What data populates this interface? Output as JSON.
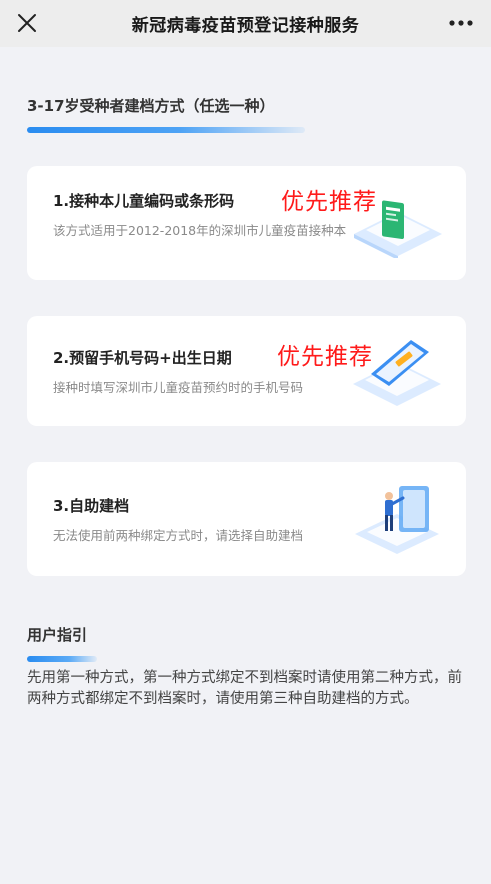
{
  "header": {
    "title": "新冠病毒疫苗预登记接种服务",
    "close_icon": "close-icon",
    "more_icon": "more-icon"
  },
  "section": {
    "title": "3-17岁受种者建档方式（任选一种）"
  },
  "cards": [
    {
      "title": "1.接种本儿童编码或条形码",
      "desc": "该方式适用于2012-2018年的深圳市儿童疫苗接种本",
      "badge": "优先推荐",
      "illustration": "vaccination-book-icon"
    },
    {
      "title": "2.预留手机号码+出生日期",
      "desc": "接种时填写深圳市儿童疫苗预约时的手机号码",
      "badge": "优先推荐",
      "illustration": "phone-icon"
    },
    {
      "title": "3.自助建档",
      "desc": "无法使用前两种绑定方式时，请选择自助建档",
      "illustration": "self-service-person-icon"
    }
  ],
  "guide": {
    "title": "用户指引",
    "text": "先用第一种方式，第一种方式绑定不到档案时请使用第二种方式，前两种方式都绑定不到档案时，请使用第三种自助建档的方式。"
  },
  "colors": {
    "accent": "#2a8cf0",
    "recommend": "#ff1a1a",
    "background": "#f1f2f6"
  }
}
